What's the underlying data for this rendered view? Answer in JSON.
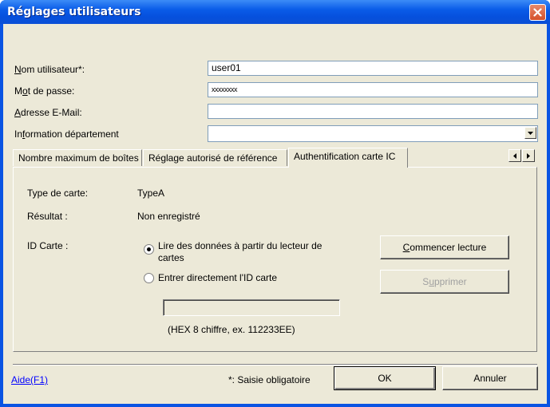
{
  "window": {
    "title": "Réglages utilisateurs"
  },
  "form": {
    "username_label": {
      "pre": "",
      "u": "N",
      "post": "om utilisateur*:"
    },
    "username_value": "user01",
    "password_label": {
      "pre": "M",
      "u": "o",
      "post": "t de passe:"
    },
    "password_value": "xxxxxxxx",
    "email_label": {
      "pre": "",
      "u": "A",
      "post": "dresse E-Mail:"
    },
    "email_value": "",
    "dept_label": {
      "pre": "In",
      "u": "f",
      "post": "ormation département"
    },
    "dept_value": ""
  },
  "tabs": [
    {
      "label": "Nombre maximum de boîtes"
    },
    {
      "label": "Réglage autorisé de référence"
    },
    {
      "label": "Authentification carte IC"
    }
  ],
  "card": {
    "type_label": "Type de carte:",
    "type_value": "TypeA",
    "result_label": "Résultat :",
    "result_value": "Non enregistré",
    "id_label": "ID Carte :",
    "radio_reader_line1": "Lire des données à partir du lecteur de",
    "radio_reader_line2": "cartes",
    "radio_direct": "Entrer directement l'ID carte",
    "hex_value": "",
    "hex_hint": "(HEX 8 chiffre, ex. 112233EE)",
    "start_button": {
      "pre": "",
      "u": "C",
      "post": "ommencer lecture"
    },
    "delete_button": {
      "pre": "S",
      "u": "u",
      "post": "pprimer"
    }
  },
  "footer": {
    "help_link": "Aide(F1)",
    "required_note": "*: Saisie obligatoire",
    "ok_label": "OK",
    "cancel_label": "Annuler"
  }
}
